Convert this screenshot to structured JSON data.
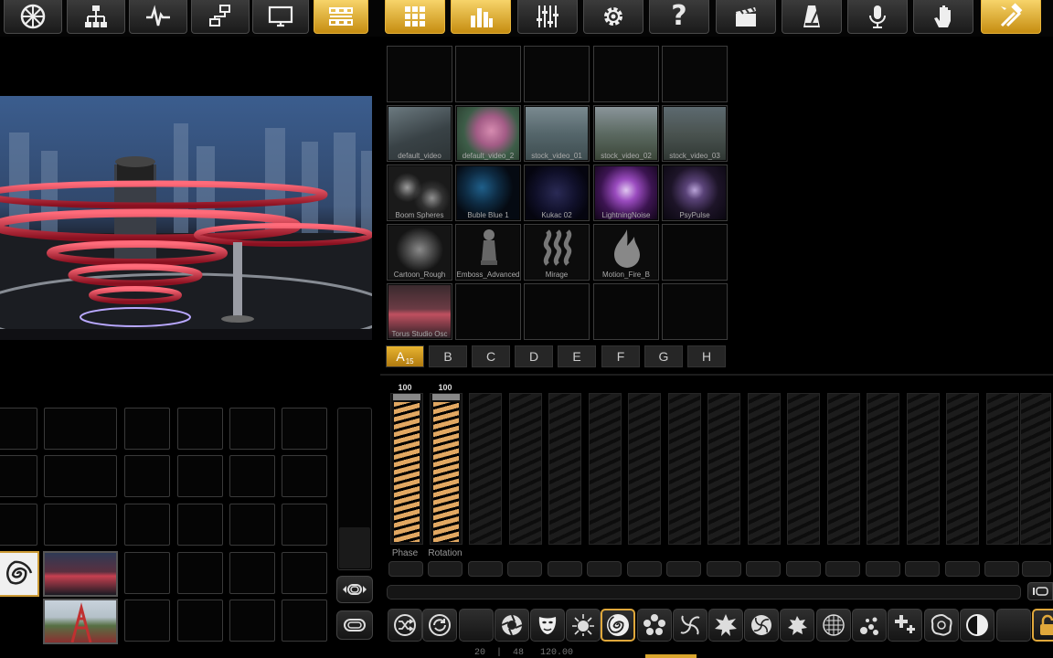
{
  "toolbar": {
    "buttons": [
      {
        "icon": "reel-icon"
      },
      {
        "icon": "hierarchy-icon"
      },
      {
        "icon": "waveform-icon"
      },
      {
        "icon": "network-icon"
      },
      {
        "icon": "monitor-icon"
      },
      {
        "icon": "matrix-icon",
        "active": true
      },
      {
        "icon": "grid-icon",
        "active": true
      },
      {
        "icon": "bar-chart-icon",
        "active": true
      },
      {
        "icon": "sliders-icon"
      },
      {
        "icon": "gear-icon"
      },
      {
        "icon": "help-icon",
        "glyph": "?"
      },
      {
        "icon": "clapperboard-icon"
      },
      {
        "icon": "metronome-icon"
      },
      {
        "icon": "microphone-icon"
      },
      {
        "icon": "hand-icon"
      },
      {
        "icon": "tools-icon",
        "active": true
      }
    ]
  },
  "clips": {
    "rows": [
      [
        {
          "label": ""
        },
        {
          "label": ""
        },
        {
          "label": ""
        },
        {
          "label": ""
        },
        {
          "label": ""
        }
      ],
      [
        {
          "label": "default_video"
        },
        {
          "label": "default_video_2"
        },
        {
          "label": "stock_video_01"
        },
        {
          "label": "stock_video_02"
        },
        {
          "label": "stock_video_03"
        }
      ],
      [
        {
          "label": "Boom Spheres"
        },
        {
          "label": "Buble Blue 1"
        },
        {
          "label": "Kukac 02"
        },
        {
          "label": "LightningNoise"
        },
        {
          "label": "PsyPulse"
        }
      ],
      [
        {
          "label": "Cartoon_Rough"
        },
        {
          "label": "Emboss_Advanced"
        },
        {
          "label": "Mirage"
        },
        {
          "label": "Motion_Fire_B"
        },
        {
          "label": ""
        }
      ],
      [
        {
          "label": "Torus Studio Osc"
        },
        {
          "label": ""
        },
        {
          "label": ""
        },
        {
          "label": ""
        },
        {
          "label": ""
        }
      ]
    ],
    "tabs": [
      "A",
      "B",
      "C",
      "D",
      "E",
      "F",
      "G",
      "H"
    ],
    "active_tab": "A",
    "active_tab_count": "15"
  },
  "faders": {
    "active": [
      {
        "value": "100",
        "label": "Phase"
      },
      {
        "value": "100",
        "label": "Rotation"
      }
    ],
    "inactive_count": 16
  },
  "effects": {
    "icons": [
      "shuffle-icon",
      "refresh-icon",
      "blank-icon",
      "aperture-icon",
      "mask-icon",
      "sunburst-icon",
      "spiral-icon",
      "flower-icon",
      "swirl-icon",
      "star-icon",
      "vortex-icon",
      "splat-icon",
      "mesh-icon",
      "droplets-icon",
      "cross-pattern-icon",
      "blob-icon",
      "contrast-icon",
      "blank-icon"
    ],
    "active_index": 6
  },
  "status": {
    "text": "20  |  48   120.00"
  }
}
